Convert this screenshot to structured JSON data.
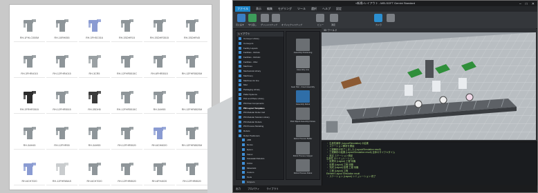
{
  "catalog": {
    "items": [
      {
        "label": "RH-1FHLC000M",
        "tint": "#8e9599",
        "icon": "scara-robot-icon"
      },
      {
        "label": "RH-10RH055",
        "tint": "#8e9599",
        "icon": "scara-robot-icon"
      },
      {
        "label": "RH-3FHSC016",
        "tint": "#8a9bd2",
        "icon": "scara-robot-icon"
      },
      {
        "label": "RH-3SDHR15",
        "tint": "#8e9599",
        "icon": "scara-robot-icon"
      },
      {
        "label": "RH-3SDHR3515",
        "tint": "#8e9599",
        "icon": "scara-robot-icon"
      },
      {
        "label": "RH-3SDHR45",
        "tint": "#8e9599",
        "icon": "scara-robot-icon"
      },
      {
        "label": "RH-3FHR4015",
        "tint": "#8e9599",
        "icon": "scara-robot-icon"
      },
      {
        "label": "RH-12FHR4015",
        "tint": "#8e9599",
        "icon": "scara-robot-icon"
      },
      {
        "label": "RH-3CR5",
        "tint": "#9aa0a3",
        "icon": "scara-robot-icon"
      },
      {
        "label": "RH-12FHR5515C",
        "tint": "#8e9599",
        "icon": "scara-robot-icon"
      },
      {
        "label": "RH-6FHR5515",
        "tint": "#8e9599",
        "icon": "scara-robot-icon"
      },
      {
        "label": "RH-12FHR5520M",
        "tint": "#8e9599",
        "icon": "scara-robot-icon"
      },
      {
        "label": "RH-3FRHR3515",
        "tint": "#2c2c2c",
        "icon": "scara-robot-icon"
      },
      {
        "label": "RH-12FHR5515",
        "tint": "#8e9599",
        "icon": "scara-robot-icon"
      },
      {
        "label": "RH-3SDH5",
        "tint": "#3a3a3a",
        "icon": "scara-robot-icon"
      },
      {
        "label": "RH-12FHR5515C",
        "tint": "#8e9599",
        "icon": "scara-robot-icon"
      },
      {
        "label": "RH-3AH55",
        "tint": "#8e9599",
        "icon": "scara-robot-icon"
      },
      {
        "label": "RH-12FHR8520M",
        "tint": "#8e9599",
        "icon": "scara-robot-icon"
      },
      {
        "label": "RH-3AH45",
        "tint": "#8e9599",
        "icon": "scara-robot-icon"
      },
      {
        "label": "RH-12FHR55",
        "tint": "#8e9599",
        "icon": "scara-robot-icon"
      },
      {
        "label": "RH-3AH55",
        "tint": "#8e9599",
        "icon": "scara-robot-icon"
      },
      {
        "label": "RH-12FHR5520",
        "tint": "#8e9599",
        "icon": "scara-robot-icon"
      },
      {
        "label": "RH-6CH6020",
        "tint": "#8a9bd2",
        "icon": "scara-robot-icon"
      },
      {
        "label": "RH-12FHR8520M",
        "tint": "#8e9599",
        "icon": "scara-robot-icon"
      },
      {
        "label": "RH-6CH7020",
        "tint": "#8a9bd2",
        "icon": "scara-robot-icon"
      },
      {
        "label": "RH-12FHR85AS",
        "tint": "#c9ccce",
        "icon": "scara-robot-icon"
      },
      {
        "label": "RH-6CH7020",
        "tint": "#8e9599",
        "icon": "scara-robot-icon"
      },
      {
        "label": "RH-12FHR8520",
        "tint": "#8e9599",
        "icon": "scara-robot-icon"
      },
      {
        "label": "RH-6FH4020",
        "tint": "#8e9599",
        "icon": "scara-robot-icon"
      },
      {
        "label": "RH-12FHR8520",
        "tint": "#8e9599",
        "icon": "scara-robot-icon"
      }
    ]
  },
  "app": {
    "title": "<新規>レイアウト - MELSOFT Gemini Standard",
    "menu": [
      "ファイル",
      "表示",
      "編集",
      "モデリング",
      "ツール",
      "選択",
      "ヘルプ",
      "設定"
    ],
    "active_menu": "ファイル",
    "ribbon": {
      "labels": [
        "元に戻す",
        "やり直し",
        "グリッドスナップ",
        "オブジェクトスナップ",
        "ビュー",
        "測定",
        "カメラ"
      ]
    },
    "tree": {
      "title": "レイアウト",
      "rows": [
        {
          "label": "Conveyor Library",
          "bold": false,
          "sub": true
        },
        {
          "label": "Conveyors",
          "bold": false,
          "sub": true
        },
        {
          "label": "Facility Layouts",
          "bold": false,
          "sub": true
        },
        {
          "label": "Facilities - Robots",
          "bold": false,
          "sub": true
        },
        {
          "label": "Facilities - Robotic",
          "bold": false,
          "sub": true
        },
        {
          "label": "Facilities - Misc",
          "bold": false,
          "sub": true
        },
        {
          "label": "Machines",
          "bold": false,
          "sub": true
        },
        {
          "label": "Mechanical Library",
          "bold": false,
          "sub": true
        },
        {
          "label": "Machinery",
          "bold": false,
          "sub": true
        },
        {
          "label": "Machines for line",
          "bold": false,
          "sub": true
        },
        {
          "label": "Misc",
          "bold": false,
          "sub": true
        },
        {
          "label": "Packaging Library",
          "bold": false,
          "sub": true
        },
        {
          "label": "Pallet Systems",
          "bold": false,
          "sub": true
        },
        {
          "label": "Pick and Place Library",
          "bold": false,
          "sub": true
        },
        {
          "label": "PM Flow Components",
          "bold": false,
          "sub": true
        },
        {
          "label": "PM Layout Templates",
          "bold": true,
          "sub": true
        },
        {
          "label": "PM Modular Robot Cell",
          "bold": false,
          "sub": true
        },
        {
          "label": "PM Modular Solution Library",
          "bold": false,
          "sub": true
        },
        {
          "label": "PM Modular Robots",
          "bold": false,
          "sub": true
        },
        {
          "label": "PM Process Modeling",
          "bold": false,
          "sub": true
        },
        {
          "label": "Robots",
          "bold": false,
          "sub": true
        },
        {
          "label": "Robot Positioners",
          "bold": false,
          "sub": true
        },
        {
          "label": "ABB",
          "bold": false,
          "sub": false
        },
        {
          "label": "Denso",
          "bold": false,
          "sub": false
        },
        {
          "label": "Epson",
          "bold": false,
          "sub": false
        },
        {
          "label": "Fanuc",
          "bold": false,
          "sub": false
        },
        {
          "label": "Kawasaki Robotics",
          "bold": false,
          "sub": false
        },
        {
          "label": "KUKA",
          "bold": false,
          "sub": false
        },
        {
          "label": "Mitsubishi",
          "bold": false,
          "sub": false
        },
        {
          "label": "Custom",
          "bold": false,
          "sub": false
        },
        {
          "label": "Tools",
          "bold": false,
          "sub": false
        },
        {
          "label": "Grippers",
          "bold": false,
          "sub": false
        }
      ]
    },
    "palette": {
      "items": [
        {
          "label": "Assembly Positioning"
        },
        {
          "label": "Assembly Line"
        },
        {
          "label": "Gear Part - Fixed Assembly"
        },
        {
          "label": "Assembly Robot"
        },
        {
          "label": "Pick Object Assembly Fixture"
        },
        {
          "label": "Robot Process Buffer"
        },
        {
          "label": "Robot Process Gripper"
        },
        {
          "label": "Robot Process Robot"
        }
      ]
    },
    "viewport": {
      "tab": "3D ワールド"
    },
    "log": [
      "・ 生産性解析 (Layout/Simulation) の結果",
      "・ ステーション解析を開始",
      "・ 工程解析が完了しました (Layout/Simulation result)",
      "・ 工程解析の結果 (Layout/Simulation result) 全体のサイクルタイム",
      "・ 設定 ステーション検証",
      "生産性 のシミュレーション",
      "・ 処理中 (Layout) 工程 待機",
      "・ 処理 (Layout) 工程 待機",
      "・ 完成 (Layout) 処理 工程 待機",
      "・ 工程 (Layout) 工程",
      "Element Layout Simulation result",
      "・ ステーション (Layout) シミュレーション 終了"
    ],
    "status": [
      "出力",
      "プロパティ",
      "ライブラリ"
    ]
  }
}
